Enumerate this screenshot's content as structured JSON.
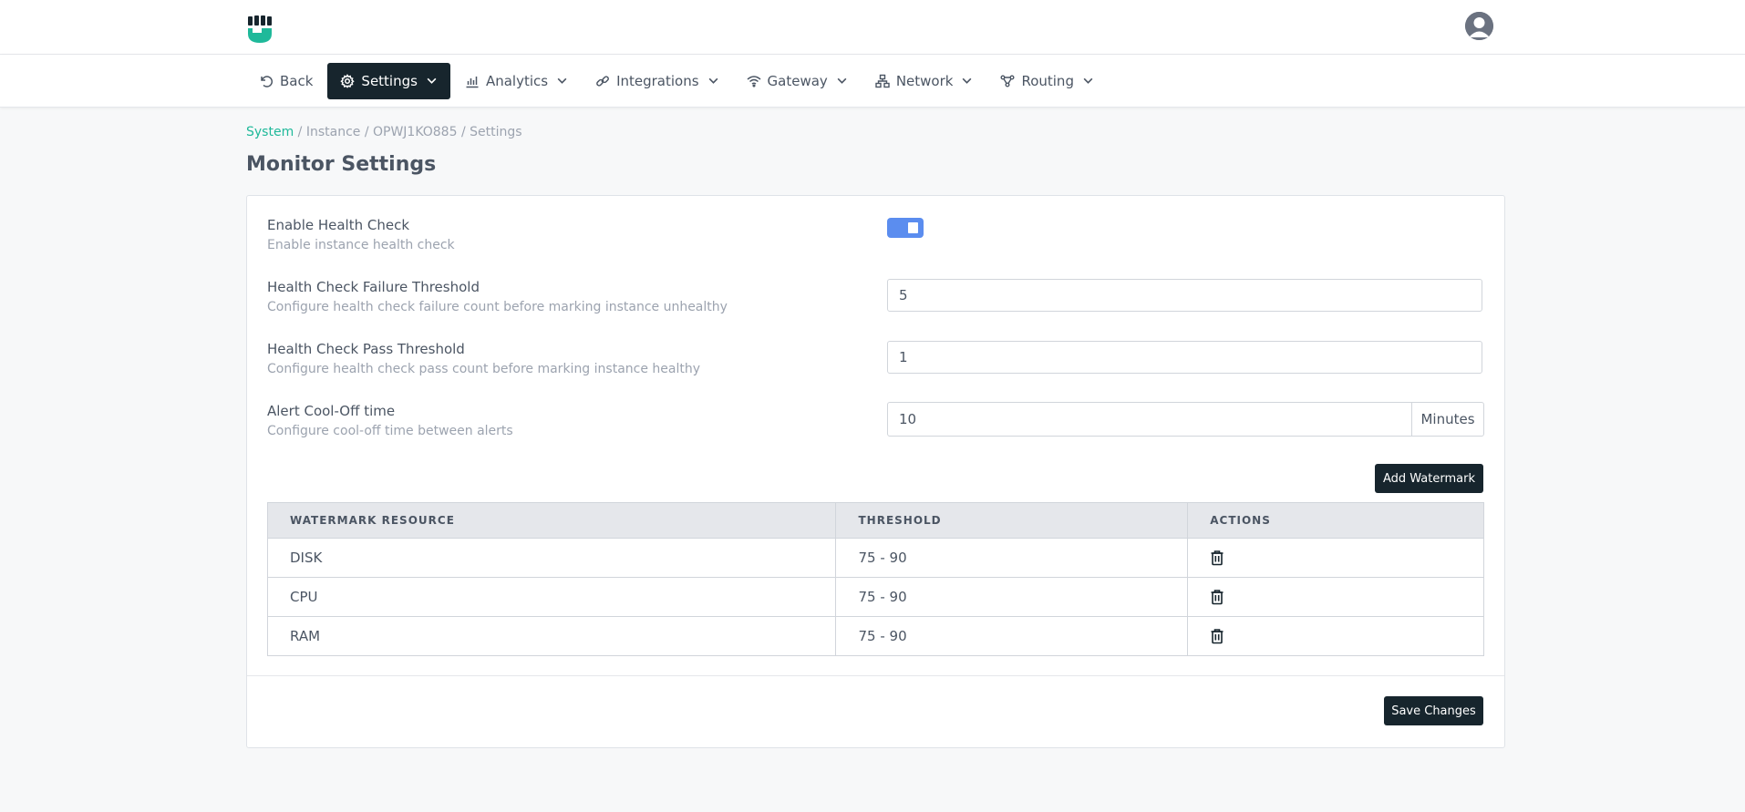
{
  "nav": [
    {
      "label": "Back",
      "icon": "undo-icon",
      "active": false,
      "dropdown": false
    },
    {
      "label": "Settings",
      "icon": "gear-icon",
      "active": true,
      "dropdown": true
    },
    {
      "label": "Analytics",
      "icon": "bar-chart-icon",
      "active": false,
      "dropdown": true
    },
    {
      "label": "Integrations",
      "icon": "link-icon",
      "active": false,
      "dropdown": true
    },
    {
      "label": "Gateway",
      "icon": "wifi-icon",
      "active": false,
      "dropdown": true
    },
    {
      "label": "Network",
      "icon": "network-icon",
      "active": false,
      "dropdown": true
    },
    {
      "label": "Routing",
      "icon": "routing-icon",
      "active": false,
      "dropdown": true
    }
  ],
  "breadcrumb": {
    "system": "System",
    "rest": " / Instance / OPWJ1KO885 / Settings"
  },
  "page_title": "Monitor Settings",
  "settings": {
    "health_check": {
      "title": "Enable Health Check",
      "desc": "Enable instance health check",
      "enabled": true
    },
    "failure_threshold": {
      "title": "Health Check Failure Threshold",
      "desc": "Configure health check failure count before marking instance unhealthy",
      "value": "5"
    },
    "pass_threshold": {
      "title": "Health Check Pass Threshold",
      "desc": "Configure health check pass count before marking instance healthy",
      "value": "1"
    },
    "cooloff": {
      "title": "Alert Cool-Off time",
      "desc": "Configure cool-off time between alerts",
      "value": "10",
      "unit": "Minutes"
    }
  },
  "add_watermark_label": "Add Watermark",
  "table": {
    "headers": [
      "WATERMARK RESOURCE",
      "THRESHOLD",
      "ACTIONS"
    ],
    "rows": [
      {
        "resource": "DISK",
        "threshold": "75 - 90"
      },
      {
        "resource": "CPU",
        "threshold": "75 - 90"
      },
      {
        "resource": "RAM",
        "threshold": "75 - 90"
      }
    ]
  },
  "save_label": "Save Changes",
  "colors": {
    "accent": "#1fb99a",
    "dark": "#17252d",
    "toggle": "#5b8def"
  }
}
